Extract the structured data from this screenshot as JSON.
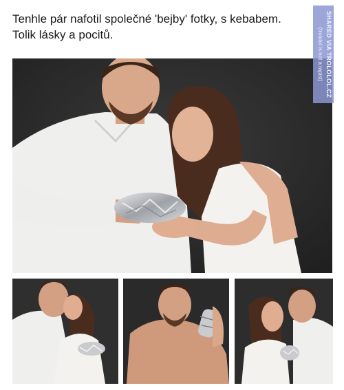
{
  "caption": {
    "line1": "Tenhle pár nafotil společné 'bejby' fotky, s kebabem.",
    "line2": "Tolik lásky a pocitů."
  },
  "watermark": {
    "line1": "SHARED VIA TROLOLOL.CZ",
    "line2": "(trololol is not a rapist)"
  },
  "colors": {
    "backdrop": "#2c2c2c",
    "foil": "#c9cbcf",
    "shirt": "#f1f1ef",
    "skin": "#d9a88a",
    "hair": "#4a2c1e",
    "watermark": "#8c96d2"
  }
}
